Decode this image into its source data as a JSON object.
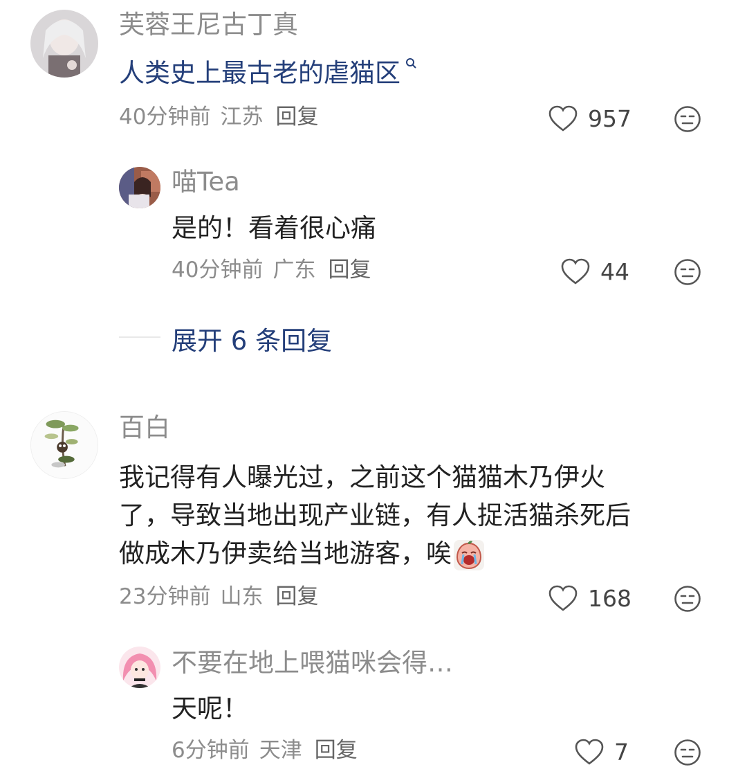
{
  "comments": [
    {
      "username": "芙蓉王尼古丁真",
      "text": "人类史上最古老的虐猫区",
      "time": "40分钟前",
      "location": "江苏",
      "reply_label": "回复",
      "likes": "957",
      "replies": [
        {
          "username": "喵Tea",
          "text": "是的！看着很心痛",
          "time": "40分钟前",
          "location": "广东",
          "reply_label": "回复",
          "likes": "44"
        }
      ],
      "expand_label": "展开 6 条回复"
    },
    {
      "username": "百白",
      "text_lines": [
        "我记得有人曝光过，之前这个猫猫木乃伊火",
        "了，导致当地出现产业链，有人捉活猫杀死后",
        "做成木乃伊卖给当地游客，唉"
      ],
      "time": "23分钟前",
      "location": "山东",
      "reply_label": "回复",
      "likes": "168",
      "replies": [
        {
          "username": "不要在地上喂猫咪会得…",
          "text": "天呢！",
          "time": "6分钟前",
          "location": "天津",
          "reply_label": "回复",
          "likes": "7"
        }
      ]
    }
  ],
  "colors": {
    "link": "#243f7a",
    "muted": "#8c8c8c",
    "text": "#222222"
  }
}
